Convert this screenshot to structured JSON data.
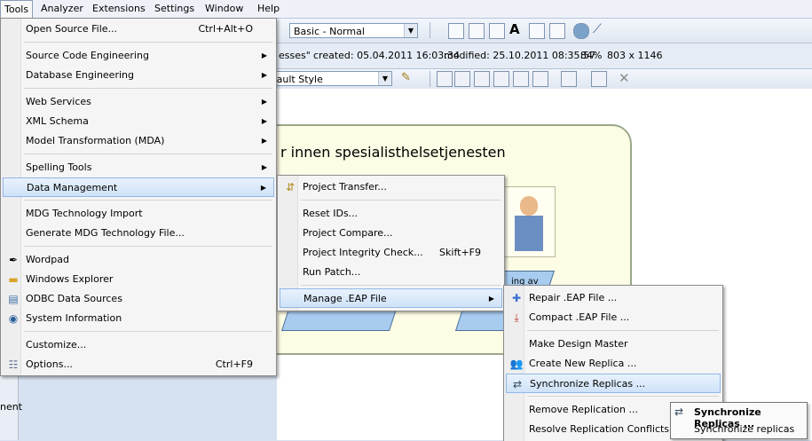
{
  "menubar": {
    "items": [
      "Tools",
      "Analyzer",
      "Extensions",
      "Settings",
      "Window",
      "Help"
    ]
  },
  "toolbar": {
    "style_combo": "Basic - Normal",
    "font_combo": "efault Style"
  },
  "info_bar": {
    "title_fragment": "esses\"",
    "created": "created: 05.04.2011 16:03:34",
    "modified": "modified: 25.10.2011 08:35:57",
    "zoom": "84%",
    "size": "803 x 1146"
  },
  "diagram": {
    "package_title": "r innen spesialisthelsetjenesten",
    "activity_label": "ing av"
  },
  "left_panel": {
    "fragment": "nent"
  },
  "tools_menu": {
    "items": [
      {
        "label": "Open Source File...",
        "shortcut": "Ctrl+Alt+O"
      },
      {
        "label": "Source Code Engineering"
      },
      {
        "label": "Database Engineering"
      },
      {
        "label": "Web Services"
      },
      {
        "label": "XML Schema"
      },
      {
        "label": "Model Transformation (MDA)"
      },
      {
        "label": "Spelling Tools"
      },
      {
        "label": "Data Management"
      },
      {
        "label": "MDG Technology Import"
      },
      {
        "label": "Generate MDG Technology File..."
      },
      {
        "label": "Wordpad"
      },
      {
        "label": "Windows Explorer"
      },
      {
        "label": "ODBC Data Sources"
      },
      {
        "label": "System Information"
      },
      {
        "label": "Customize..."
      },
      {
        "label": "Options...",
        "shortcut": "Ctrl+F9"
      }
    ]
  },
  "data_menu": {
    "items": [
      {
        "label": "Project Transfer..."
      },
      {
        "label": "Reset IDs..."
      },
      {
        "label": "Project Compare..."
      },
      {
        "label": "Project Integrity Check...",
        "shortcut": "Skift+F9"
      },
      {
        "label": "Run Patch..."
      },
      {
        "label": "Manage .EAP File"
      }
    ]
  },
  "eap_menu": {
    "items": [
      {
        "label": "Repair .EAP File ..."
      },
      {
        "label": "Compact .EAP File ..."
      },
      {
        "label": "Make Design Master"
      },
      {
        "label": "Create New Replica ..."
      },
      {
        "label": "Synchronize Replicas ..."
      },
      {
        "label": "Remove Replication ..."
      },
      {
        "label": "Resolve Replication Conflicts..."
      }
    ]
  },
  "tooltip": {
    "title": "Synchronize Replicas ...",
    "text": "Synchronize replicas"
  }
}
